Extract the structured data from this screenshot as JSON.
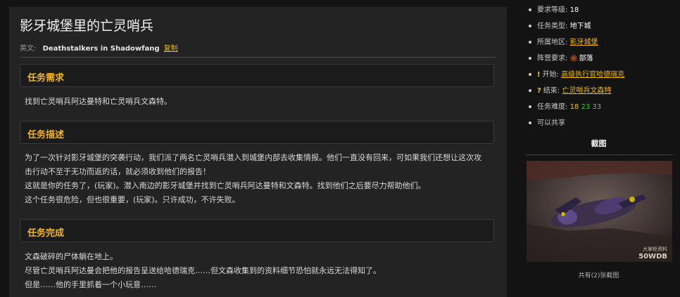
{
  "quest": {
    "title": "影牙城堡里的亡灵哨兵",
    "english_label": "英文:",
    "english_name": "Deathstalkers in Shadowfang",
    "copy_label": "复制"
  },
  "sections": [
    {
      "heading": "任务需求",
      "lines": [
        "找到亡灵哨兵阿达曼特和亡灵哨兵文森特。"
      ]
    },
    {
      "heading": "任务描述",
      "lines": [
        "为了一次针对影牙城堡的突袭行动，我们派了两名亡灵哨兵潜入到城堡内部去收集情报。他们一直没有回来，可如果我们还想让这次攻",
        "击行动不至于无功而返的话，就必须收到他们的报告！",
        "这就是你的任务了，(玩家)。潜入南边的影牙城堡并找到亡灵哨兵阿达曼特和文森特。找到他们之后要尽力帮助他们。",
        "这个任务很危险，但也很重要，(玩家)。只许成功，不许失败。"
      ]
    },
    {
      "heading": "任务完成",
      "lines": [
        "文森破碎的尸体躺在地上。",
        "尽管亡灵哨兵阿达曼会把他的报告呈送给哈德瑞克……但文森收集到的资料细节恐怕就永远无法得知了。",
        "但是……他的手里抓着一个小玩意……"
      ]
    }
  ],
  "sidebar": {
    "level_label": "要求等级:",
    "level_value": "18",
    "type_label": "任务类型:",
    "type_value": "地下城",
    "zone_label": "所属地区:",
    "zone_value": "影牙城堡",
    "faction_label": "阵营要求:",
    "faction_value": "部落",
    "faction_icon": "horde-icon",
    "start_label": "开始:",
    "start_value": "高级执行官哈德瑞克",
    "end_label": "结束:",
    "end_value": "亡灵哨兵文森特",
    "difficulty_label": "任务难度:",
    "difficulty": [
      "18",
      "23",
      "33"
    ],
    "shareable": "可以共享",
    "screenshots_title": "截图",
    "screenshot_watermark": "50WDB",
    "screenshot_watermark_cn": "大掌柜资料",
    "screenshots_caption": "共有(2)张截图"
  },
  "colors": {
    "accent": "#f0b429",
    "link": "#f0b800",
    "panel": "#232323",
    "bg": "#131313"
  }
}
